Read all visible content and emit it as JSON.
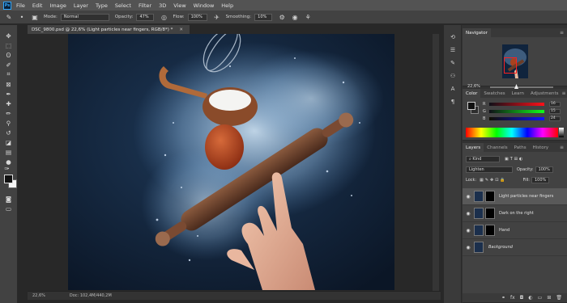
{
  "app": {
    "logo_text": "Ps"
  },
  "menu": [
    "File",
    "Edit",
    "Image",
    "Layer",
    "Type",
    "Select",
    "Filter",
    "3D",
    "View",
    "Window",
    "Help"
  ],
  "options": {
    "mode_label": "Mode:",
    "mode_value": "Normal",
    "opacity_label": "Opacity:",
    "opacity_value": "47%",
    "flow_label": "Flow:",
    "flow_value": "100%",
    "smoothing_label": "Smoothing:",
    "smoothing_value": "10%"
  },
  "document": {
    "tab_title": "DSC_9800.psd @ 22,6% (Light particles near fingers, RGB/8*) *",
    "zoom": "22,6%",
    "doc_size": "Doc: 102,4M/440,2M"
  },
  "navigator": {
    "tab": "Navigator",
    "zoom": "22,6%"
  },
  "color_panel": {
    "tabs": [
      "Color",
      "Swatches",
      "Learn",
      "Adjustments"
    ],
    "r_label": "R",
    "r_value": "16",
    "g_label": "G",
    "g_value": "15",
    "b_label": "B",
    "b_value": "24"
  },
  "layers_panel": {
    "tabs": [
      "Layers",
      "Channels",
      "Paths",
      "History"
    ],
    "kind": "Kind",
    "blend_mode": "Lighten",
    "opacity_label": "Opacity:",
    "opacity_value": "100%",
    "lock_label": "Lock:",
    "fill_label": "Fill:",
    "fill_value": "100%",
    "layers": [
      {
        "name": "Light particles near fingers",
        "selected": true
      },
      {
        "name": "Dark on the right",
        "selected": false
      },
      {
        "name": "Hand",
        "selected": false
      },
      {
        "name": "Background",
        "selected": false
      }
    ]
  },
  "colors": {
    "accent": "#31a8ff",
    "selection_red": "#ff2020"
  }
}
